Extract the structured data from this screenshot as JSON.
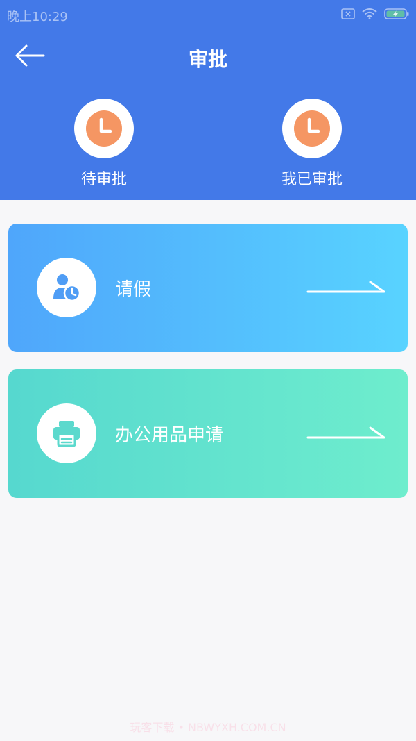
{
  "status_bar": {
    "time": "晚上10:29",
    "icons": [
      "sim-off-icon",
      "wifi-icon",
      "battery-charging-icon"
    ]
  },
  "header": {
    "back_icon": "arrow-left-icon",
    "title": "审批",
    "tabs": [
      {
        "label": "待审批",
        "icon": "clock-icon"
      },
      {
        "label": "我已审批",
        "icon": "clock-icon"
      }
    ]
  },
  "cards": [
    {
      "label": "请假",
      "icon": "user-clock-icon",
      "arrow": "long-arrow-right-icon"
    },
    {
      "label": "办公用品申请",
      "icon": "printer-icon",
      "arrow": "long-arrow-right-icon"
    }
  ],
  "watermark": "玩客下载 • NBWYXH.COM.CN",
  "colors": {
    "header_bg": "#4379e8",
    "clock_orange": "#f59663",
    "leave_gradient": [
      "#4fa6fb",
      "#58d3ff"
    ],
    "supplies_gradient": [
      "#56d8cf",
      "#6eedcd"
    ],
    "page_bg": "#f7f7f9"
  }
}
